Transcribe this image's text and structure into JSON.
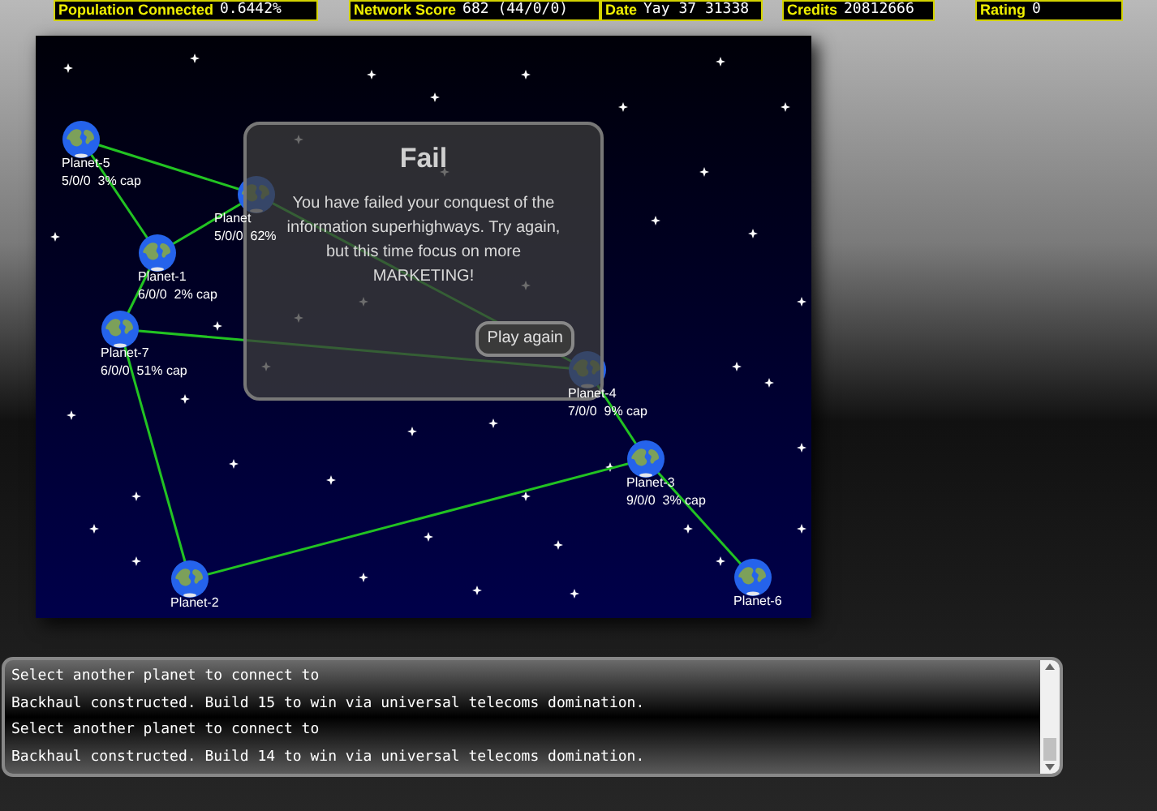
{
  "stats": [
    {
      "label": "Population Connected",
      "value": "0.6442%"
    },
    {
      "label": "Network Score",
      "value": "682 (44/0/0)"
    },
    {
      "label": "Date",
      "value": "Yay 37 31338"
    },
    {
      "label": "Credits",
      "value": "20812666"
    },
    {
      "label": "Rating",
      "value": "0"
    }
  ],
  "map": {
    "planets": [
      {
        "name": "Planet-5",
        "stats": "5/0/0  3% cap"
      },
      {
        "name": "Planet",
        "stats": "5/0/0  62%"
      },
      {
        "name": "Planet-1",
        "stats": "6/0/0  2% cap"
      },
      {
        "name": "Planet-7",
        "stats": "6/0/0  51% cap"
      },
      {
        "name": "Planet-4",
        "stats": "7/0/0  9% cap"
      },
      {
        "name": "Planet-3",
        "stats": "9/0/0  3% cap"
      },
      {
        "name": "Planet-6"
      },
      {
        "name": "Planet-2"
      }
    ]
  },
  "dialog": {
    "title": "Fail",
    "message": "You have failed your conquest of the information superhighways. Try again, but this time focus on more MARKETING!",
    "button": "Play again"
  },
  "log": [
    "Select another planet to connect to",
    "Backhaul constructed. Build 15 to win via universal telecoms domination.",
    "Select another planet to connect to",
    "Backhaul constructed. Build 14 to win via universal telecoms domination."
  ]
}
